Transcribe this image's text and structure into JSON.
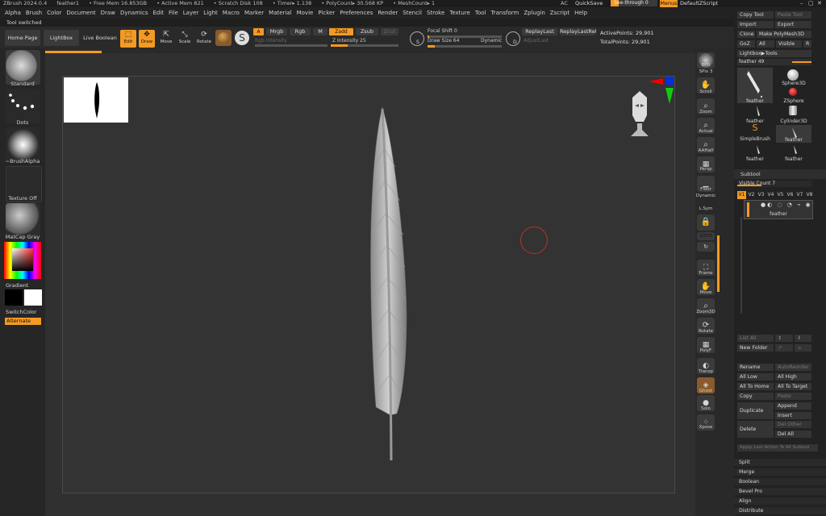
{
  "titlebar": {
    "app": "ZBrush 2024.0.4",
    "doc": "feather1",
    "free_mem": "• Free Mem 16.853GB",
    "active_mem": "• Active Mem 821",
    "scratch": "• Scratch Disk 108",
    "timer": "• Timer▸ 1.138",
    "polycount": "• PolyCount▸ 30.568 KP",
    "meshcount": "• MeshCount▸ 1",
    "ac": "AC",
    "quicksave": "QuickSave",
    "see_through": "See-through  0",
    "menus": "Menus",
    "script": "DefaultZScript"
  },
  "menu": [
    "Alpha",
    "Brush",
    "Color",
    "Document",
    "Draw",
    "Dynamics",
    "Edit",
    "File",
    "Layer",
    "Light",
    "Macro",
    "Marker",
    "Material",
    "Movie",
    "Picker",
    "Preferences",
    "Render",
    "Stencil",
    "Stroke",
    "Texture",
    "Tool",
    "Transform",
    "Zplugin",
    "Zscript",
    "Help"
  ],
  "status": "Tool switched",
  "toolbar": {
    "home": "Home Page",
    "lightbox": "LightBox",
    "live_boolean": "Live Boolean",
    "edit": "Edit",
    "draw": "Draw",
    "move": "Move",
    "scale": "Scale",
    "rotate": "Rotate",
    "a": "A",
    "mrgb": "Mrgb",
    "rgb": "Rgb",
    "m": "M",
    "rgb_intensity": "Rgb Intensity",
    "zadd": "Zadd",
    "zsub": "Zsub",
    "zcut": "Zcut",
    "z_intensity": "Z Intensity 25",
    "focal_shift": "Focal Shift 0",
    "draw_size": "Draw Size 64",
    "dynamic": "Dynamic",
    "replay_last": "ReplayLast",
    "replay_last_rel": "ReplayLastRel",
    "adjust_last": "AdjustLast",
    "active_points": "ActivePoints: 29,901",
    "total_points": "TotalPoints: 29,901",
    "s_label": "S",
    "d_label": "D"
  },
  "left": {
    "standard": "Standard",
    "dots": "Dots",
    "brush_alpha": "~BrushAlpha",
    "texture_off": "Texture Off",
    "matcap": "MatCap Gray",
    "gradient": "Gradient",
    "switch_color": "SwitchColor",
    "alternate": "Alternate"
  },
  "dock": {
    "bpr": "BPR",
    "spix": "SPix 3",
    "scroll": "Scroll",
    "zoom": "Zoom",
    "actual": "Actual",
    "aahalf": "AAHalf",
    "persp": "Persp",
    "floor": "Floor",
    "dynamic": "Dynamic",
    "lsym": "L.Sym",
    "xyz": "QXYZ",
    "frame": "Frame",
    "move": "Move",
    "zoom3d": "Zoom3D",
    "rotate": "Rotate",
    "polyf": "PolyF",
    "transp": "Transp",
    "ghost": "Ghost",
    "solo": "Solo",
    "xpose": "Xpose"
  },
  "right": {
    "copy_tool": "Copy Tool",
    "paste_tool": "Paste Tool",
    "import": "Import",
    "export": "Export",
    "clone": "Clone",
    "make_polymesh": "Make PolyMesh3D",
    "goz": "GoZ",
    "all": "All",
    "visible": "Visible",
    "r": "R",
    "lightbox_tools": "Lightbox▶Tools",
    "feather_slider": "feather  49",
    "tools": [
      "feather",
      "Sphere3D",
      "feather",
      "ZSphere",
      "feather",
      "Cylinder3D",
      "SimpleBrush",
      "feather",
      "feather",
      "feather"
    ],
    "subtool": "Subtool",
    "visible_count": "Visible Count 7",
    "versions": [
      "V1",
      "V2",
      "V3",
      "V4",
      "V5",
      "V6",
      "V7",
      "V8"
    ],
    "subtool_item": "feather",
    "list_all": "List All",
    "new_folder": "New Folder",
    "rename": "Rename",
    "auto_reorder": "AutoReorder",
    "all_low": "All Low",
    "all_high": "All High",
    "all_to_home": "All To Home",
    "all_to_target": "All To Target",
    "copy": "Copy",
    "paste": "Paste",
    "duplicate": "Duplicate",
    "append": "Append",
    "insert": "Insert",
    "delete": "Delete",
    "del_other": "Del Other",
    "del_all": "Del All",
    "apply_last": "Apply Last Action To All Subtool",
    "split": "Split",
    "merge": "Merge",
    "boolean": "Boolean",
    "bevel_pro": "Bevel Pro",
    "align": "Align",
    "distribute": "Distribute"
  },
  "colors": {
    "accent": "#f39a24",
    "bg": "#2b2b2b",
    "panel": "#222222"
  }
}
